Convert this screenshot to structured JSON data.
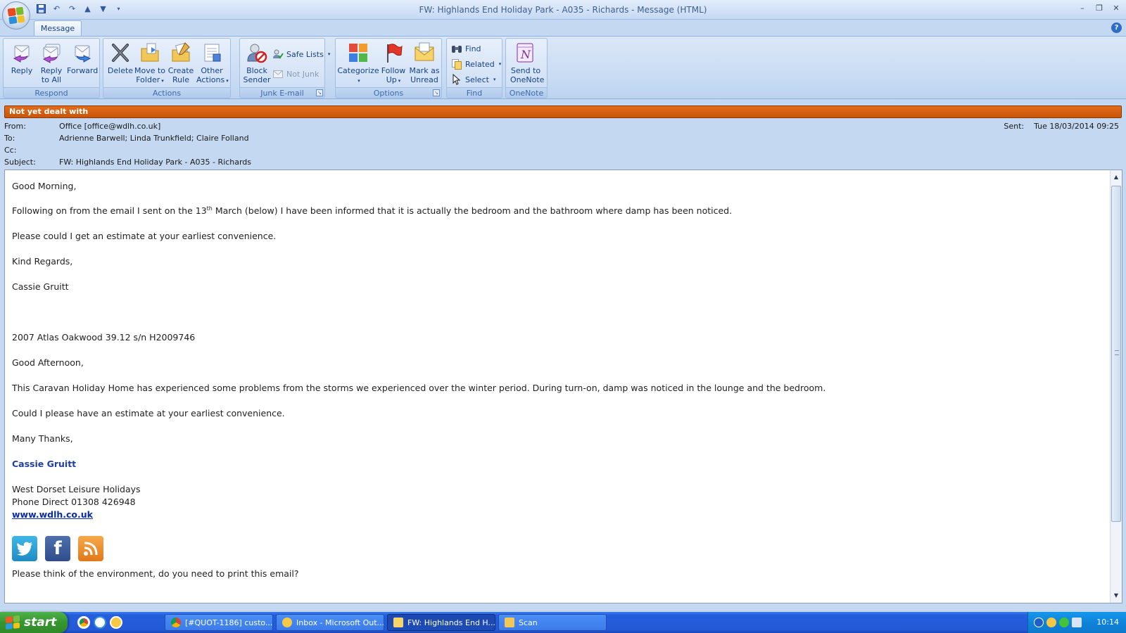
{
  "window": {
    "title": "FW: Highlands End Holiday Park - A035 - Richards - Message (HTML)"
  },
  "tabs": {
    "message": "Message"
  },
  "ribbon": {
    "respond": {
      "label": "Respond",
      "reply": [
        "Reply",
        ""
      ],
      "reply_all": [
        "Reply",
        "to All"
      ],
      "forward": [
        "Forward",
        ""
      ]
    },
    "actions": {
      "label": "Actions",
      "delete": [
        "Delete",
        ""
      ],
      "move_to_folder": [
        "Move to",
        "Folder"
      ],
      "create_rule": [
        "Create",
        "Rule"
      ],
      "other_actions": [
        "Other",
        "Actions"
      ]
    },
    "junk": {
      "label": "Junk E-mail",
      "block_sender": [
        "Block",
        "Sender"
      ],
      "safe_lists": "Safe Lists",
      "not_junk": "Not Junk"
    },
    "options": {
      "label": "Options",
      "categorize": [
        "Categorize",
        ""
      ],
      "follow_up": [
        "Follow",
        "Up"
      ],
      "mark_as_unread": [
        "Mark as",
        "Unread"
      ]
    },
    "find": {
      "label": "Find",
      "find": "Find",
      "related": "Related",
      "select": "Select"
    },
    "onenote": {
      "label": "OneNote",
      "send_to_onenote": [
        "Send to",
        "OneNote"
      ]
    }
  },
  "infobar": {
    "text": "Not yet dealt with"
  },
  "header": {
    "from_label": "From:",
    "from": "Office [office@wdlh.co.uk]",
    "to_label": "To:",
    "to": "Adrienne Barwell; Linda Trunkfield; Claire Folland",
    "cc_label": "Cc:",
    "cc": "",
    "subject_label": "Subject:",
    "subject": "FW: Highlands End Holiday Park - A035 - Richards",
    "sent_label": "Sent:",
    "sent": "Tue 18/03/2014 09:25"
  },
  "body": {
    "greeting": "Good Morning,",
    "p1_a": "Following on from the email I sent on the 13",
    "p1_sup": "th",
    "p1_b": " March (below) I have been informed that it is actually the bedroom and the bathroom where damp has been noticed.",
    "p2": "Please could I get an estimate at your earliest convenience.",
    "closing": "Kind Regards,",
    "sender": "Cassie Gruitt",
    "fwd_ref": "2007 Atlas Oakwood 39.12 s/n H2009746",
    "fwd_greeting": "Good Afternoon,",
    "fwd_p1": "This Caravan Holiday Home has experienced some problems from the storms we experienced over the winter period. During turn-on, damp was noticed in the lounge and the bedroom.",
    "fwd_p2": "Could I please have an estimate at your earliest convenience.",
    "fwd_closing": "Many Thanks,",
    "sig_name": "Cassie Gruitt",
    "sig_company": "West Dorset Leisure Holidays",
    "sig_phone": "Phone Direct 01308 426948",
    "sig_web": "www.wdlh.co.uk",
    "footer": "Please think of the environment, do you need to print this email?"
  },
  "social": {
    "twitter": "twitter-icon",
    "facebook": "facebook-icon",
    "rss": "rss-icon"
  },
  "taskbar": {
    "start": "start",
    "items": [
      "[#QUOT-1186] custo...",
      "Inbox - Microsoft Out...",
      "FW: Highlands End H...",
      "Scan"
    ],
    "clock": "10:14"
  },
  "colors": {
    "infobar": "#d8600f",
    "ribbon": "#c4d8f1",
    "link": "#0a2ca8",
    "taskbar": "#245edb",
    "start": "#37952f"
  }
}
